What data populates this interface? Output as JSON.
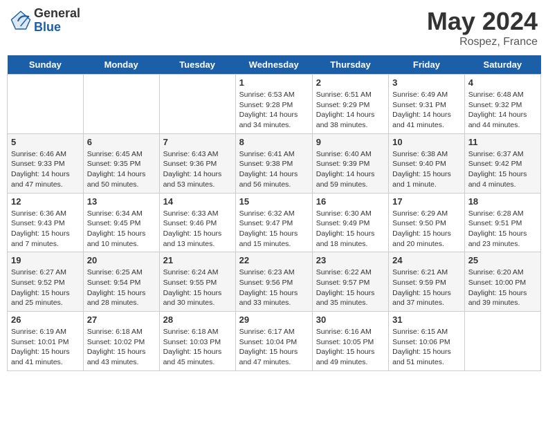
{
  "header": {
    "logo_general": "General",
    "logo_blue": "Blue",
    "month_year": "May 2024",
    "location": "Rospez, France"
  },
  "days_of_week": [
    "Sunday",
    "Monday",
    "Tuesday",
    "Wednesday",
    "Thursday",
    "Friday",
    "Saturday"
  ],
  "weeks": [
    {
      "days": [
        {
          "number": "",
          "info": ""
        },
        {
          "number": "",
          "info": ""
        },
        {
          "number": "",
          "info": ""
        },
        {
          "number": "1",
          "info": "Sunrise: 6:53 AM\nSunset: 9:28 PM\nDaylight: 14 hours\nand 34 minutes."
        },
        {
          "number": "2",
          "info": "Sunrise: 6:51 AM\nSunset: 9:29 PM\nDaylight: 14 hours\nand 38 minutes."
        },
        {
          "number": "3",
          "info": "Sunrise: 6:49 AM\nSunset: 9:31 PM\nDaylight: 14 hours\nand 41 minutes."
        },
        {
          "number": "4",
          "info": "Sunrise: 6:48 AM\nSunset: 9:32 PM\nDaylight: 14 hours\nand 44 minutes."
        }
      ]
    },
    {
      "days": [
        {
          "number": "5",
          "info": "Sunrise: 6:46 AM\nSunset: 9:33 PM\nDaylight: 14 hours\nand 47 minutes."
        },
        {
          "number": "6",
          "info": "Sunrise: 6:45 AM\nSunset: 9:35 PM\nDaylight: 14 hours\nand 50 minutes."
        },
        {
          "number": "7",
          "info": "Sunrise: 6:43 AM\nSunset: 9:36 PM\nDaylight: 14 hours\nand 53 minutes."
        },
        {
          "number": "8",
          "info": "Sunrise: 6:41 AM\nSunset: 9:38 PM\nDaylight: 14 hours\nand 56 minutes."
        },
        {
          "number": "9",
          "info": "Sunrise: 6:40 AM\nSunset: 9:39 PM\nDaylight: 14 hours\nand 59 minutes."
        },
        {
          "number": "10",
          "info": "Sunrise: 6:38 AM\nSunset: 9:40 PM\nDaylight: 15 hours\nand 1 minute."
        },
        {
          "number": "11",
          "info": "Sunrise: 6:37 AM\nSunset: 9:42 PM\nDaylight: 15 hours\nand 4 minutes."
        }
      ]
    },
    {
      "days": [
        {
          "number": "12",
          "info": "Sunrise: 6:36 AM\nSunset: 9:43 PM\nDaylight: 15 hours\nand 7 minutes."
        },
        {
          "number": "13",
          "info": "Sunrise: 6:34 AM\nSunset: 9:45 PM\nDaylight: 15 hours\nand 10 minutes."
        },
        {
          "number": "14",
          "info": "Sunrise: 6:33 AM\nSunset: 9:46 PM\nDaylight: 15 hours\nand 13 minutes."
        },
        {
          "number": "15",
          "info": "Sunrise: 6:32 AM\nSunset: 9:47 PM\nDaylight: 15 hours\nand 15 minutes."
        },
        {
          "number": "16",
          "info": "Sunrise: 6:30 AM\nSunset: 9:49 PM\nDaylight: 15 hours\nand 18 minutes."
        },
        {
          "number": "17",
          "info": "Sunrise: 6:29 AM\nSunset: 9:50 PM\nDaylight: 15 hours\nand 20 minutes."
        },
        {
          "number": "18",
          "info": "Sunrise: 6:28 AM\nSunset: 9:51 PM\nDaylight: 15 hours\nand 23 minutes."
        }
      ]
    },
    {
      "days": [
        {
          "number": "19",
          "info": "Sunrise: 6:27 AM\nSunset: 9:52 PM\nDaylight: 15 hours\nand 25 minutes."
        },
        {
          "number": "20",
          "info": "Sunrise: 6:25 AM\nSunset: 9:54 PM\nDaylight: 15 hours\nand 28 minutes."
        },
        {
          "number": "21",
          "info": "Sunrise: 6:24 AM\nSunset: 9:55 PM\nDaylight: 15 hours\nand 30 minutes."
        },
        {
          "number": "22",
          "info": "Sunrise: 6:23 AM\nSunset: 9:56 PM\nDaylight: 15 hours\nand 33 minutes."
        },
        {
          "number": "23",
          "info": "Sunrise: 6:22 AM\nSunset: 9:57 PM\nDaylight: 15 hours\nand 35 minutes."
        },
        {
          "number": "24",
          "info": "Sunrise: 6:21 AM\nSunset: 9:59 PM\nDaylight: 15 hours\nand 37 minutes."
        },
        {
          "number": "25",
          "info": "Sunrise: 6:20 AM\nSunset: 10:00 PM\nDaylight: 15 hours\nand 39 minutes."
        }
      ]
    },
    {
      "days": [
        {
          "number": "26",
          "info": "Sunrise: 6:19 AM\nSunset: 10:01 PM\nDaylight: 15 hours\nand 41 minutes."
        },
        {
          "number": "27",
          "info": "Sunrise: 6:18 AM\nSunset: 10:02 PM\nDaylight: 15 hours\nand 43 minutes."
        },
        {
          "number": "28",
          "info": "Sunrise: 6:18 AM\nSunset: 10:03 PM\nDaylight: 15 hours\nand 45 minutes."
        },
        {
          "number": "29",
          "info": "Sunrise: 6:17 AM\nSunset: 10:04 PM\nDaylight: 15 hours\nand 47 minutes."
        },
        {
          "number": "30",
          "info": "Sunrise: 6:16 AM\nSunset: 10:05 PM\nDaylight: 15 hours\nand 49 minutes."
        },
        {
          "number": "31",
          "info": "Sunrise: 6:15 AM\nSunset: 10:06 PM\nDaylight: 15 hours\nand 51 minutes."
        },
        {
          "number": "",
          "info": ""
        }
      ]
    }
  ]
}
